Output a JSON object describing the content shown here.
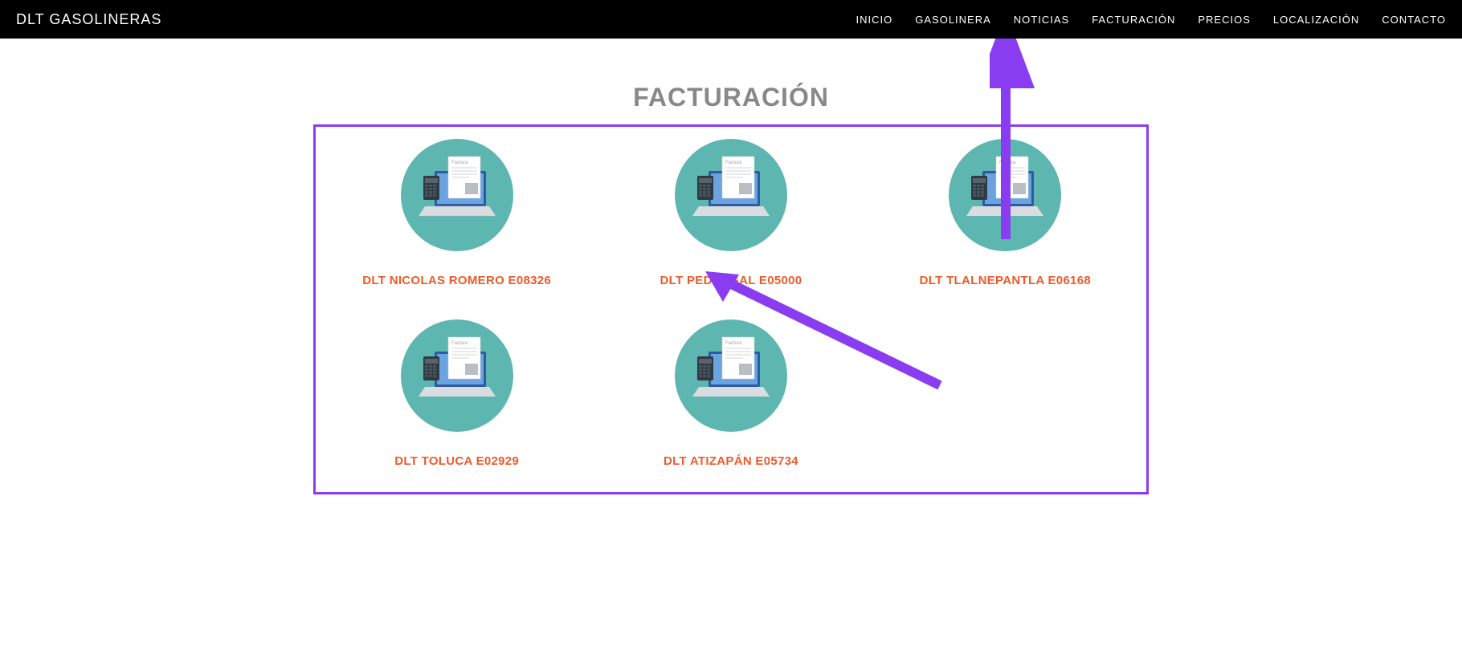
{
  "brand": "DLT GASOLINERAS",
  "nav": [
    "INICIO",
    "GASOLINERA",
    "NOTICIAS",
    "FACTURACIÓN",
    "PRECIOS",
    "LOCALIZACIÓN",
    "CONTACTO"
  ],
  "page_title": "FACTURACIÓN",
  "icon_doc_label": "Factura",
  "stations": [
    "DLT NICOLAS ROMERO E08326",
    "DLT PEDREGAL E05000",
    "DLT TLALNEPANTLA E06168",
    "DLT TOLUCA E02929",
    "DLT ATIZAPÁN E05734"
  ],
  "colors": {
    "annotation": "#8a3cf0",
    "link": "#ed5a29",
    "icon_bg": "#5db6b0"
  }
}
